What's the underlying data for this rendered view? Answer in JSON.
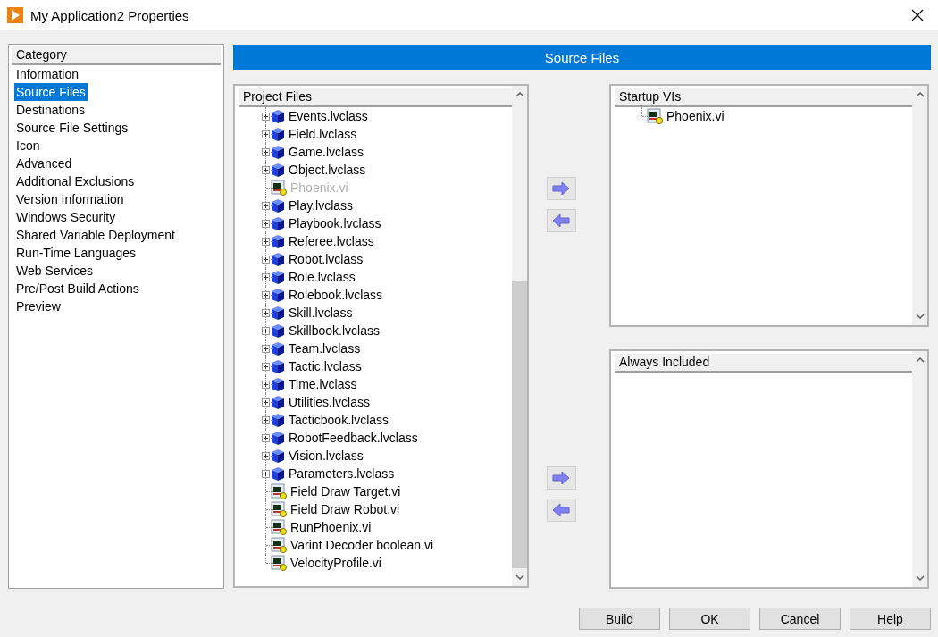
{
  "window": {
    "title": "My Application2 Properties"
  },
  "category": {
    "heading": "Category",
    "items": [
      {
        "label": "Information",
        "selected": false
      },
      {
        "label": "Source Files",
        "selected": true
      },
      {
        "label": "Destinations",
        "selected": false
      },
      {
        "label": "Source File Settings",
        "selected": false
      },
      {
        "label": "Icon",
        "selected": false
      },
      {
        "label": "Advanced",
        "selected": false
      },
      {
        "label": "Additional Exclusions",
        "selected": false
      },
      {
        "label": "Version Information",
        "selected": false
      },
      {
        "label": "Windows Security",
        "selected": false
      },
      {
        "label": "Shared Variable Deployment",
        "selected": false
      },
      {
        "label": "Run-Time Languages",
        "selected": false
      },
      {
        "label": "Web Services",
        "selected": false
      },
      {
        "label": "Pre/Post Build Actions",
        "selected": false
      },
      {
        "label": "Preview",
        "selected": false
      }
    ]
  },
  "page_title": "Source Files",
  "project_files": {
    "heading": "Project Files",
    "items": [
      {
        "kind": "class",
        "label": "Events.lvclass",
        "disabled": false
      },
      {
        "kind": "class",
        "label": "Field.lvclass",
        "disabled": false
      },
      {
        "kind": "class",
        "label": "Game.lvclass",
        "disabled": false
      },
      {
        "kind": "class",
        "label": "Object.lvclass",
        "disabled": false
      },
      {
        "kind": "vi",
        "label": "Phoenix.vi",
        "disabled": true
      },
      {
        "kind": "class",
        "label": "Play.lvclass",
        "disabled": false
      },
      {
        "kind": "class",
        "label": "Playbook.lvclass",
        "disabled": false
      },
      {
        "kind": "class",
        "label": "Referee.lvclass",
        "disabled": false
      },
      {
        "kind": "class",
        "label": "Robot.lvclass",
        "disabled": false
      },
      {
        "kind": "class",
        "label": "Role.lvclass",
        "disabled": false
      },
      {
        "kind": "class",
        "label": "Rolebook.lvclass",
        "disabled": false
      },
      {
        "kind": "class",
        "label": "Skill.lvclass",
        "disabled": false
      },
      {
        "kind": "class",
        "label": "Skillbook.lvclass",
        "disabled": false
      },
      {
        "kind": "class",
        "label": "Team.lvclass",
        "disabled": false
      },
      {
        "kind": "class",
        "label": "Tactic.lvclass",
        "disabled": false
      },
      {
        "kind": "class",
        "label": "Time.lvclass",
        "disabled": false
      },
      {
        "kind": "class",
        "label": "Utilities.lvclass",
        "disabled": false
      },
      {
        "kind": "class",
        "label": "Tacticbook.lvclass",
        "disabled": false
      },
      {
        "kind": "class",
        "label": "RobotFeedback.lvclass",
        "disabled": false
      },
      {
        "kind": "class",
        "label": "Vision.lvclass",
        "disabled": false
      },
      {
        "kind": "class",
        "label": "Parameters.lvclass",
        "disabled": false
      },
      {
        "kind": "vi",
        "label": "Field Draw Target.vi",
        "disabled": false
      },
      {
        "kind": "vi",
        "label": "Field Draw Robot.vi",
        "disabled": false
      },
      {
        "kind": "vi",
        "label": "RunPhoenix.vi",
        "disabled": false
      },
      {
        "kind": "vi",
        "label": "Varint Decoder boolean.vi",
        "disabled": false
      },
      {
        "kind": "vi",
        "label": "VelocityProfile.vi",
        "disabled": false
      }
    ]
  },
  "startup_vis": {
    "heading": "Startup VIs",
    "items": [
      {
        "kind": "vi",
        "label": "Phoenix.vi",
        "disabled": false
      }
    ]
  },
  "always_included": {
    "heading": "Always Included"
  },
  "buttons": [
    "Build",
    "OK",
    "Cancel",
    "Help"
  ]
}
